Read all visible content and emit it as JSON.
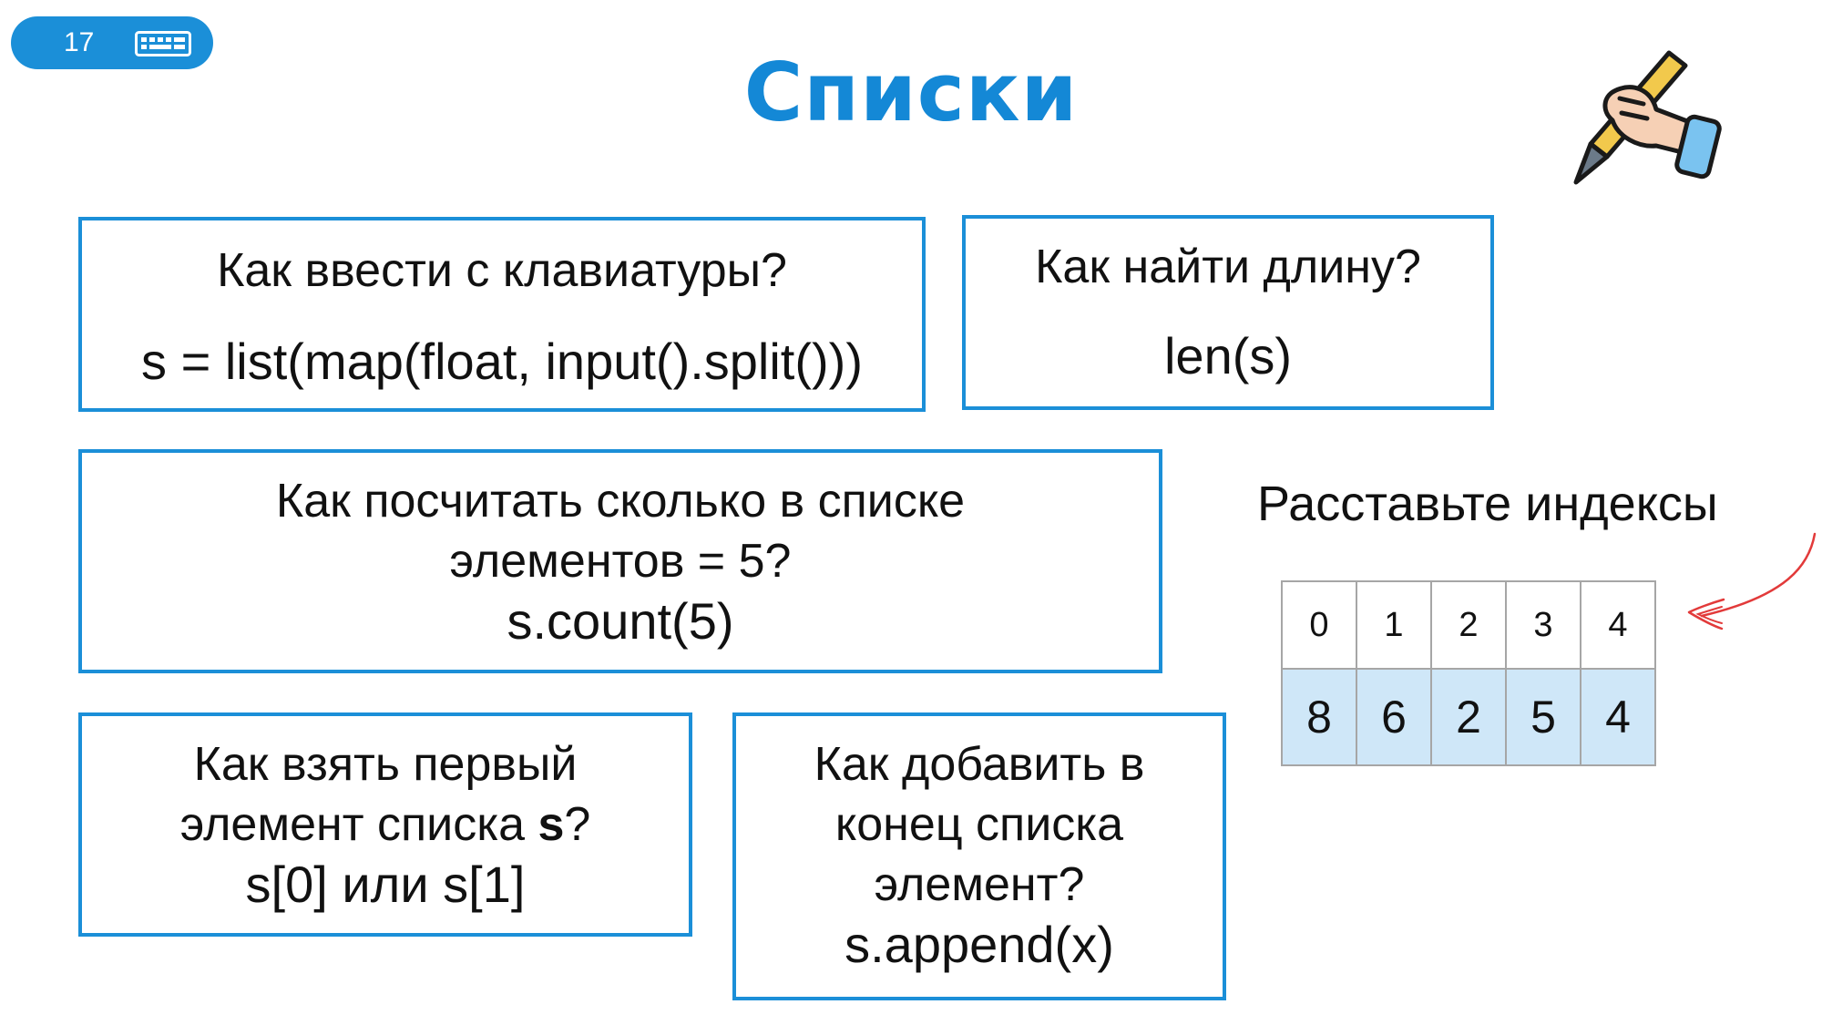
{
  "slide_number": "17",
  "title": "Списки",
  "colors": {
    "accent": "#1b8fd8",
    "title": "#1488d6",
    "cell_fill": "#cfe7f8",
    "arrow": "#e23a3a"
  },
  "icons": [
    "keyboard-icon",
    "writing-hand-icon",
    "curved-arrow-icon"
  ],
  "cards": [
    {
      "question": "Как ввести с клавиатуры?",
      "answer": "s = list(map(float, input().split()))"
    },
    {
      "question": "Как найти длину?",
      "answer": "len(s)"
    },
    {
      "question_lines": [
        "Как посчитать сколько в списке",
        "элементов = 5?"
      ],
      "answer": "s.count(5)"
    },
    {
      "question_line1": "Как взять первый",
      "question_line2_before": "элемент списка ",
      "question_bold": "s",
      "question_line2_after": "?",
      "answer": "s[0] или s[1]"
    },
    {
      "question_lines": [
        "Как добавить в",
        "конец списка",
        "элемент?"
      ],
      "answer": "s.append(x)"
    }
  ],
  "index_task": {
    "label": "Расставьте индексы",
    "indices": [
      "0",
      "1",
      "2",
      "3",
      "4"
    ],
    "values": [
      "8",
      "6",
      "2",
      "5",
      "4"
    ]
  }
}
